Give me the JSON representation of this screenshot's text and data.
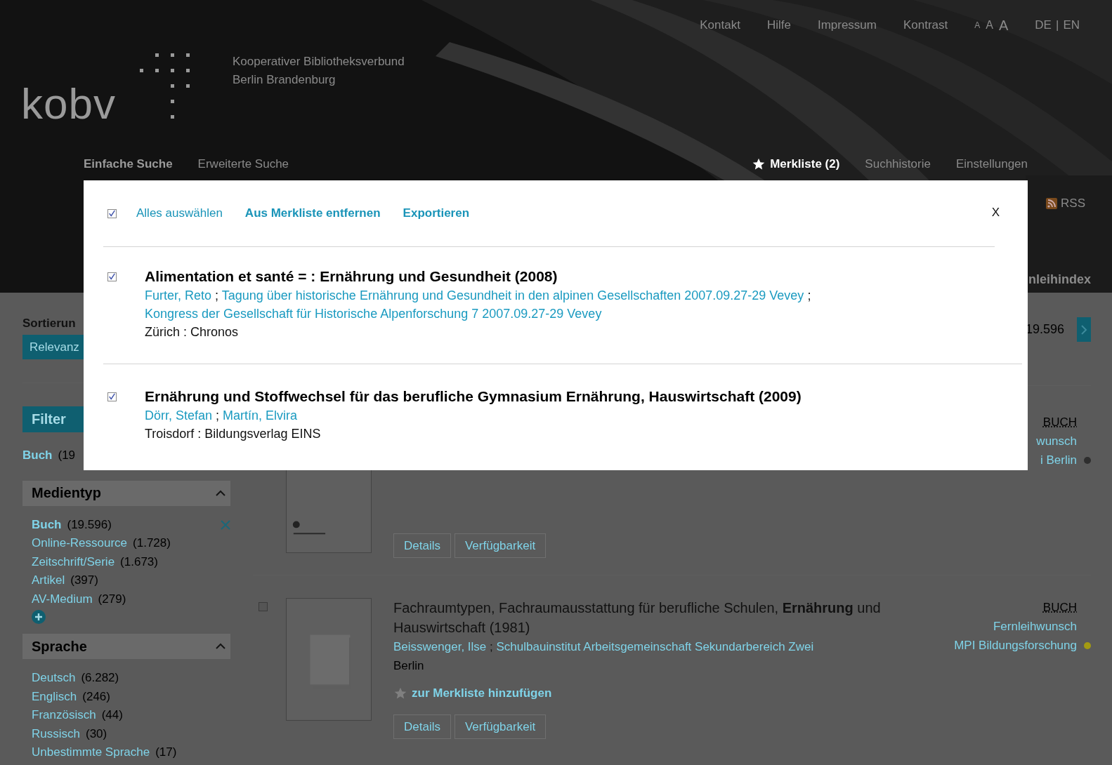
{
  "top_links": [
    {
      "label": "Kontakt"
    },
    {
      "label": "Hilfe"
    },
    {
      "label": "Impressum"
    },
    {
      "label": "Kontrast"
    }
  ],
  "font_sizes": [
    {
      "label": "A"
    },
    {
      "label": "A"
    },
    {
      "label": "A"
    }
  ],
  "languages": [
    {
      "label": "DE"
    },
    {
      "label": "EN"
    }
  ],
  "language_separator": "|",
  "logo": {
    "wordmark": "kobv",
    "tagline": [
      "Kooperativer Bibliotheksverbund",
      "Berlin Brandenburg"
    ]
  },
  "nav_left": [
    {
      "label": "Einfache Suche",
      "selected": true
    },
    {
      "label": "Erweiterte Suche",
      "selected": false
    }
  ],
  "nav_right": [
    {
      "label": "Merkliste (2)",
      "selected": true,
      "kind": "favorites"
    },
    {
      "label": "Suchhistorie",
      "selected": false,
      "kind": "link"
    },
    {
      "label": "Einstellungen",
      "selected": false,
      "kind": "link"
    }
  ],
  "rss": "RSS",
  "tab_fragment": "nleihindex",
  "sidebar": {
    "sort_label": "Sortierun",
    "sort_button": "Relevanz",
    "filter_title": "Filter",
    "active_filter": {
      "label": "Buch",
      "count": "(19"
    },
    "facets": [
      {
        "title": "Medientyp",
        "expanded": true,
        "more": true,
        "items": [
          {
            "label": "Buch",
            "count": "(19.596)",
            "selected": true
          },
          {
            "label": "Online-Ressource",
            "count": "(1.728)",
            "selected": false
          },
          {
            "label": "Zeitschrift/Serie",
            "count": "(1.673)",
            "selected": false
          },
          {
            "label": "Artikel",
            "count": "(397)",
            "selected": false
          },
          {
            "label": "AV-Medium",
            "count": "(279)",
            "selected": false
          }
        ]
      },
      {
        "title": "Sprache",
        "expanded": true,
        "more": false,
        "items": [
          {
            "label": "Deutsch",
            "count": "(6.282)",
            "selected": false
          },
          {
            "label": "Englisch",
            "count": "(246)",
            "selected": false
          },
          {
            "label": "Französisch",
            "count": "(44)",
            "selected": false
          },
          {
            "label": "Russisch",
            "count": "(30)",
            "selected": false
          },
          {
            "label": "Unbestimmte Sprache",
            "count": "(17)",
            "selected": false
          }
        ]
      }
    ]
  },
  "pagination": {
    "total": "19.596"
  },
  "author_separator": ";",
  "results": [
    {
      "type_label": "BUCH",
      "links": [
        "wunsch",
        "i Berlin"
      ],
      "color": "#2e2e2e",
      "buttons": [
        "Details",
        "Verfügbarkeit"
      ]
    },
    {
      "checked": false,
      "title": "Fachraumtypen, Fachraumausstattung für berufliche Schulen, **Ernährung** und Hauswirtschaft (1981)",
      "authors": [
        "Beisswenger, Ilse",
        "Schulbauinstitut Arbeitsgemeinschaft Sekundarbereich Zwei"
      ],
      "publisher": "Berlin",
      "add_label": "zur Merkliste hinzufügen",
      "type_label": "BUCH",
      "links": [
        "Fernleihwunsch",
        "MPI Bildungsforschung"
      ],
      "color": "#a39a12",
      "buttons": [
        "Details",
        "Verfügbarkeit"
      ]
    }
  ],
  "dialog": {
    "select_all": {
      "label": "Alles auswählen",
      "checked": true
    },
    "actions": [
      "Aus Merkliste entfernen",
      "Exportieren"
    ],
    "close": "X",
    "items": [
      {
        "checked": true,
        "title": "Alimentation et santé = : Ernährung und Gesundheit (2008)",
        "authors": [
          "Furter, Reto",
          "Tagung über historische Ernährung und Gesundheit in den alpinen Gesellschaften 2007.09.27-29 Vevey",
          "Kongress der Gesellschaft für Historische Alpenforschung 7 2007.09.27-29 Vevey"
        ],
        "publisher": "Zürich : Chronos"
      },
      {
        "checked": true,
        "title": "Ernährung und Stoffwechsel für das berufliche Gymnasium Ernährung, Hauswirtschaft (2009)",
        "authors": [
          "Dörr, Stefan",
          "Martín, Elvira"
        ],
        "publisher": "Troisdorf : Bildungsverlag EINS"
      }
    ]
  }
}
